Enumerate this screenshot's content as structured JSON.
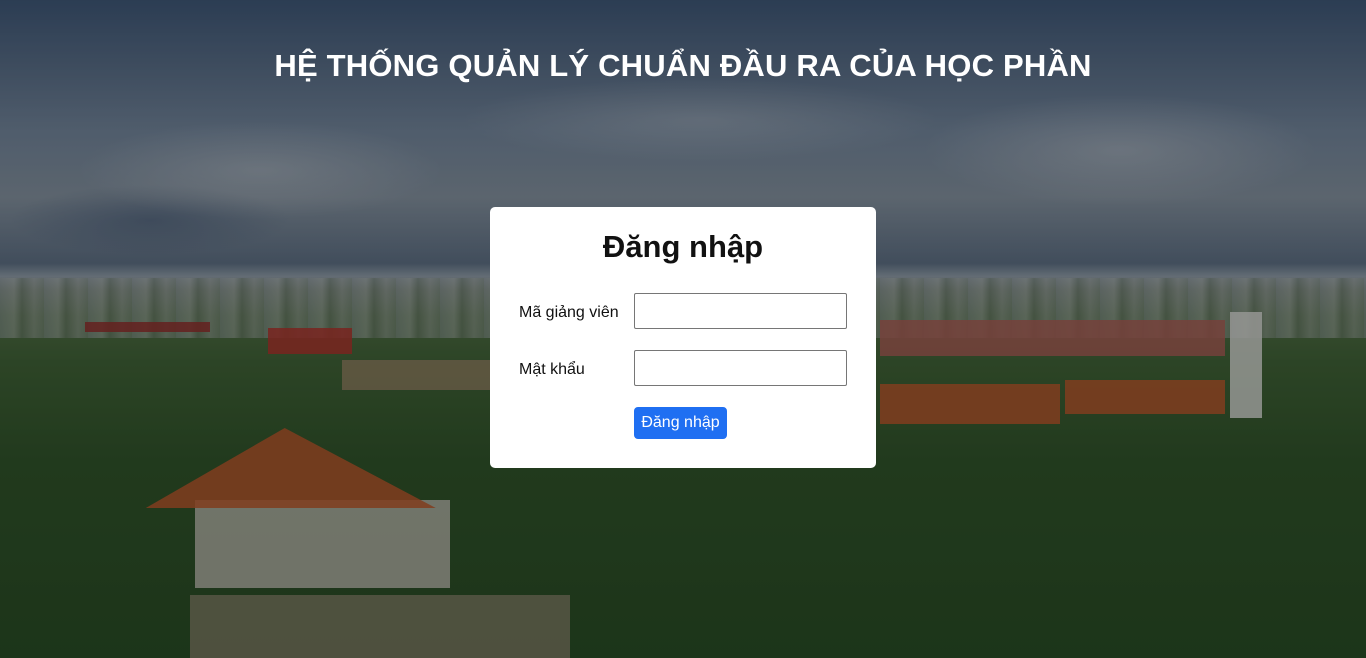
{
  "header": {
    "title": "HỆ THỐNG QUẢN LÝ CHUẨN ĐẦU RA CỦA HỌC PHẦN"
  },
  "login": {
    "heading": "Đăng nhập",
    "username_label": "Mã giảng viên",
    "username_value": "",
    "password_label": "Mật khẩu",
    "password_value": "",
    "submit_label": "Đăng nhập"
  },
  "colors": {
    "accent": "#1f6ff2",
    "card_background": "#ffffff",
    "title_text": "#ffffff"
  }
}
